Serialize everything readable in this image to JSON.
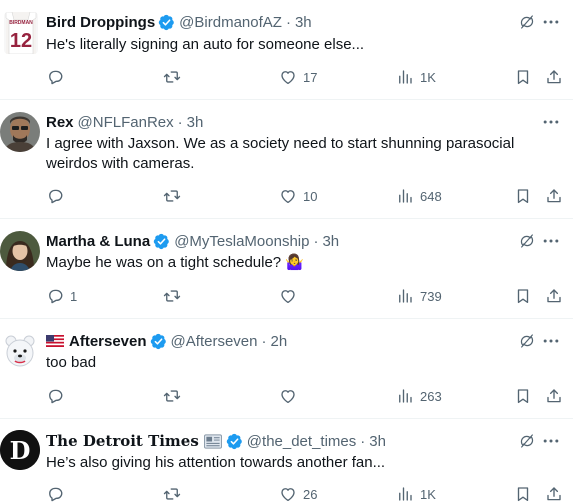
{
  "tweets": [
    {
      "name": "Bird Droppings",
      "handle": "@BirdmanofAZ",
      "time": "3h",
      "text": "He's literally signing an auto for someone else...",
      "avatar_text_top": "BIRDMAN",
      "avatar_text_number": "12",
      "replies": "",
      "retweets": "",
      "likes": "17",
      "views": "1K"
    },
    {
      "name": "Rex",
      "handle": "@NFLFanRex",
      "time": "3h",
      "text": "I agree with Jaxson. We as a society  need to start shunning parasocial weirdos with cameras.",
      "replies": "",
      "retweets": "",
      "likes": "10",
      "views": "648"
    },
    {
      "name": "Martha & Luna",
      "handle": "@MyTeslaMoonship",
      "time": "3h",
      "text": "Maybe he was on a tight schedule? 🤷‍♀️",
      "replies": "1",
      "retweets": "",
      "likes": "",
      "views": "739"
    },
    {
      "name": "Afterseven",
      "handle": "@Afterseven",
      "time": "2h",
      "text": "too bad",
      "replies": "",
      "retweets": "",
      "likes": "",
      "views": "263"
    },
    {
      "name": "The Detroit Times",
      "handle": "@the_det_times",
      "time": "3h",
      "text": "He’s also giving his attention towards another fan...",
      "avatar_letter": "D",
      "replies": "",
      "retweets": "",
      "likes": "26",
      "views": "1K"
    }
  ],
  "separator": "·",
  "colors": {
    "verified_blue": "#1d9bf0",
    "secondary_text": "#536471",
    "divider": "#eff3f4",
    "cardinals_red": "#97233f"
  },
  "icons": {
    "reply": "reply-icon",
    "retweet": "retweet-icon",
    "like": "heart-icon",
    "views": "views-icon",
    "bookmark": "bookmark-icon",
    "share": "share-icon",
    "more": "more-icon",
    "grok": "grok-icon",
    "verified": "verified-badge-icon",
    "newspaper": "newspaper-emoji-icon",
    "flag": "us-flag-icon"
  }
}
